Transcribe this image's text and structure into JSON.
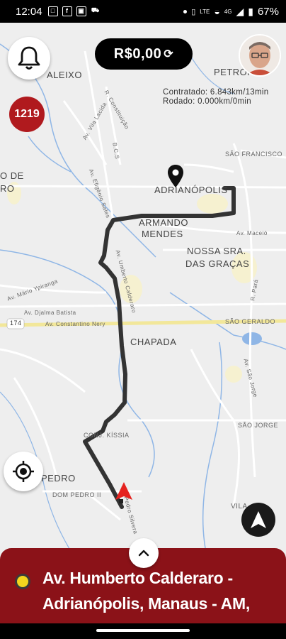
{
  "status_bar": {
    "time": "12:04",
    "battery": "67%",
    "network": "4G"
  },
  "header": {
    "fare": "R$0,00",
    "refresh_icon": "refresh-icon"
  },
  "stats": {
    "contracted": "Contratado: 6.843km/13min",
    "driven": "Rodado: 0.000km/0min"
  },
  "brand": {
    "logo_text": "1219"
  },
  "map": {
    "areas": {
      "aleixo": "ALEIXO",
      "petropolis": "PETRÓPO",
      "sao_francisco": "SÃO FRANCISCO",
      "adrianopolis": "ADRIANÓPOLIS",
      "armando_mendes_1": "ARMANDO",
      "armando_mendes_2": "MENDES",
      "nossa_sra_1": "NOSSA SRA.",
      "nossa_sra_2": "DAS GRAÇAS",
      "chapada": "CHAPADA",
      "sao_geraldo": "SÃO GERALDO",
      "sao_jorge": "SÃO JORGE",
      "conj_kissia": "CONJ. KÍSSIA",
      "pedro": "PEDRO",
      "dom_pedro": "DOM PEDRO II",
      "vila": "VILA",
      "left_top_1": "O DE",
      "left_top_2": "RO"
    },
    "streets": {
      "constantino": "Av. Constantino Nery",
      "djalma": "Av. Djalma Batista",
      "mario": "Av. Mário Ypiranga",
      "maceio": "Av. Maceió",
      "para": "R. Pará",
      "sao_jorge": "Av. São Jorge",
      "efigenio": "Av. Efigênio Sales",
      "umberto": "Av. Umberto Calderaro",
      "vila_lacida": "Av. Vila Lacida",
      "constituicao": "R. Constituição",
      "bcs": "B.C.S",
      "silvera": "Av. Pedro Silvera",
      "highway": "174"
    }
  },
  "destination": {
    "address_line1": "Av. Humberto Calderaro -",
    "address_line2": "Adrianópolis, Manaus - AM,"
  },
  "icons": {
    "bell": "bell-icon",
    "avatar": "avatar",
    "locate": "locate-icon",
    "navigate": "navigation-arrow-icon",
    "pin": "destination-pin-icon",
    "car": "current-location-icon",
    "chevron": "chevron-up-icon"
  },
  "colors": {
    "brand_red": "#8b1218",
    "route": "#333333",
    "map_bg": "#eeeeee",
    "major_road": "#f2e79a",
    "dot_yellow": "#f2d51e"
  }
}
